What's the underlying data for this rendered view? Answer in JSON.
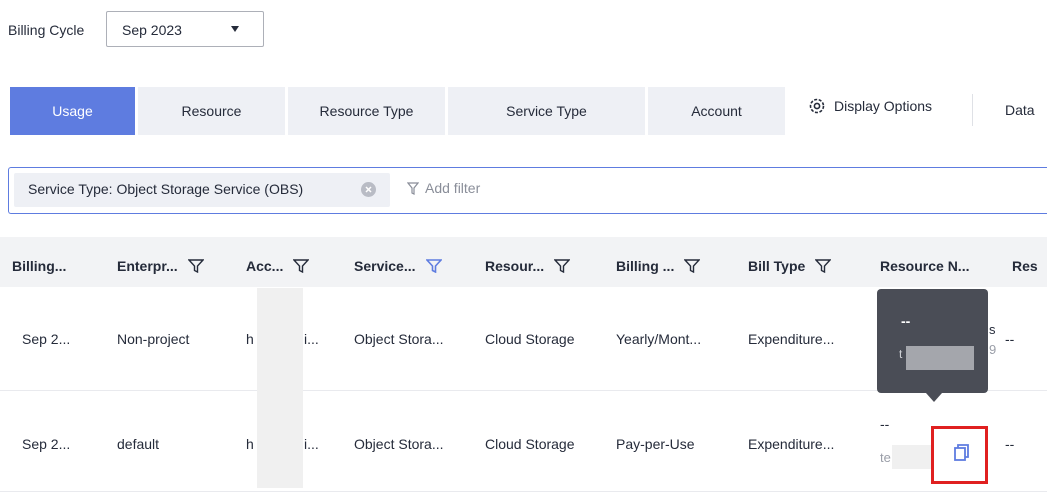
{
  "billing_cycle": {
    "label": "Billing Cycle",
    "value": "Sep 2023"
  },
  "tabs": [
    {
      "label": "Usage",
      "active": true
    },
    {
      "label": "Resource",
      "active": false
    },
    {
      "label": "Resource Type",
      "active": false
    },
    {
      "label": "Service Type",
      "active": false
    },
    {
      "label": "Account",
      "active": false
    }
  ],
  "display_options": "Display Options",
  "data_link": "Data",
  "filter": {
    "tag": "Service Type: Object Storage Service (OBS)",
    "add_placeholder": "Add filter"
  },
  "columns": [
    "Billing...",
    "Enterpr...",
    "Acc...",
    "Service...",
    "Resour...",
    "Billing ...",
    "Bill Type",
    "Resource N...",
    "Res"
  ],
  "rows": [
    {
      "cycle": "Sep 2...",
      "project": "Non-project",
      "account_start": "h",
      "account_end": "i...",
      "service": "Object Stora...",
      "resource_type": "Cloud Storage",
      "billing_mode": "Yearly/Mont...",
      "bill_type": "Expenditure...",
      "resource_name_1": "s",
      "resource_name_2": "9",
      "res": "--"
    },
    {
      "cycle": "Sep 2...",
      "project": "default",
      "account_start": "h",
      "account_end": "i...",
      "service": "Object Stora...",
      "resource_type": "Cloud Storage",
      "billing_mode": "Pay-per-Use",
      "bill_type": "Expenditure...",
      "resource_name_1": "--",
      "resource_name_2": "te",
      "res": "--"
    }
  ],
  "tooltip": {
    "line1": "--",
    "line2": "t"
  },
  "colors": {
    "accent": "#5e7ce0",
    "highlight": "#e02020",
    "tooltip_bg": "#4a4d56"
  }
}
